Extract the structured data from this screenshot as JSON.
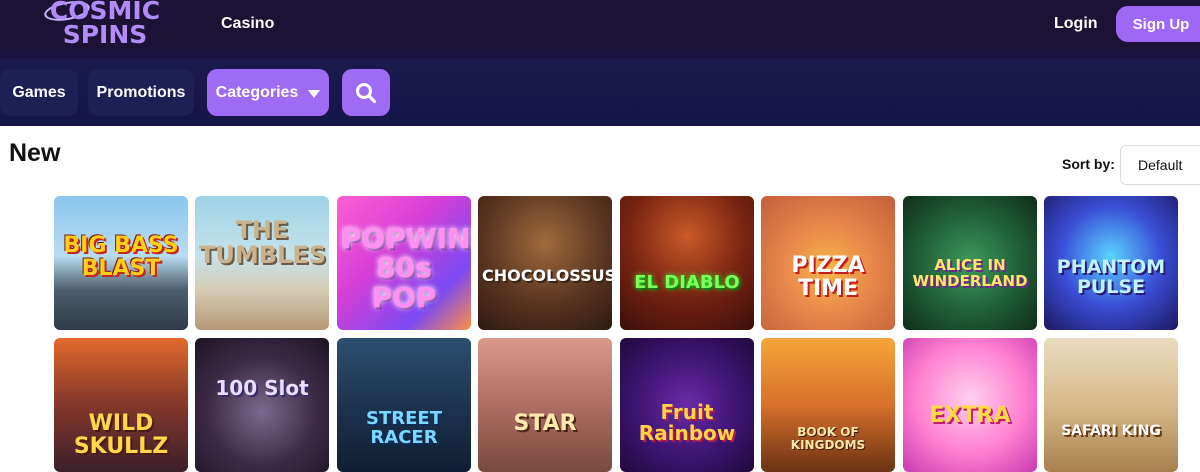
{
  "brand": {
    "line1": "COSMIC",
    "line2": "SPINS"
  },
  "topbar": {
    "casino": "Casino",
    "login": "Login",
    "signup": "Sign Up"
  },
  "nav": {
    "games": "Games",
    "promotions": "Promotions",
    "categories": "Categories"
  },
  "section": {
    "title": "New",
    "sort_label": "Sort by:",
    "sort_value": "Default"
  },
  "games": {
    "row1": [
      "BIG BASS BLAST",
      "THE TUMBLES",
      "POPWINS 80s POP",
      "CHOCOLOSSUS",
      "EL DIABLO",
      "PIZZA TIME",
      "ALICE IN WINDERLAND",
      "PHANTOM PULSE"
    ],
    "row2": [
      "WILD SKULLZ",
      "100 Slot",
      "STREET RACER",
      "STAR",
      "Fruit Rainbow",
      "BOOK OF KINGDOMS",
      "EXTRA",
      "SAFARI KING"
    ]
  }
}
